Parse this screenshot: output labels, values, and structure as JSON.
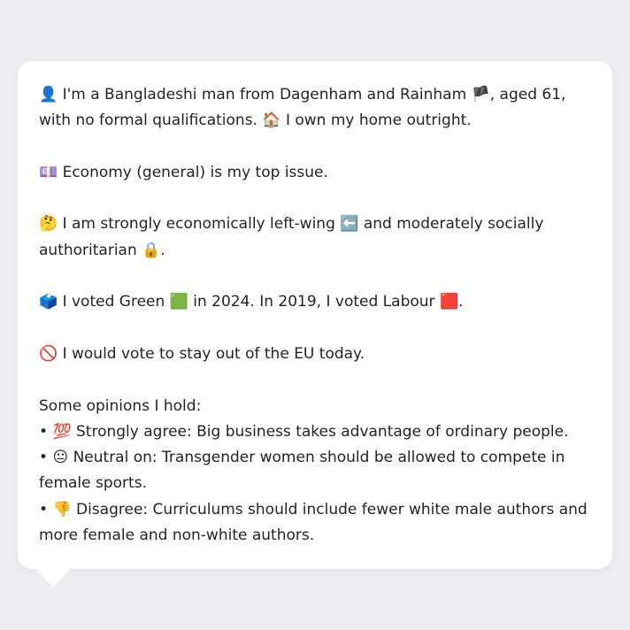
{
  "profile": {
    "intro": {
      "icon": "👤",
      "text1": " I'm a Bangladeshi man from Dagenham and Rainham ",
      "flag": "🏴",
      "text2": ", aged 61, with no formal qualifications. ",
      "home_icon": "🏠",
      "text3": " I own my home outright."
    },
    "issue": {
      "icon": "💷",
      "text": " Economy (general) is my top issue."
    },
    "politics": {
      "icon": "🤔",
      "text1": " I am strongly economically left-wing ",
      "left_icon": "⬅️",
      "text2": " and moderately socially authoritarian ",
      "lock_icon": "🔒",
      "text3": "."
    },
    "votes": {
      "icon": "🗳️",
      "text1": " I voted Green ",
      "green_icon": "🟩",
      "text2": " in 2024. In 2019, I voted Labour ",
      "red_icon": "🟥",
      "text3": "."
    },
    "eu": {
      "icon": "🚫",
      "text": " I would vote to stay out of the EU today."
    },
    "opinions_heading": "Some opinions I hold:",
    "opinions": [
      {
        "bullet": "• ",
        "icon": "💯",
        "text": " Strongly agree: Big business takes advantage of ordinary people."
      },
      {
        "bullet": "• ",
        "icon": "😐",
        "text": " Neutral on: Transgender women should be allowed to compete in female sports."
      },
      {
        "bullet": "• ",
        "icon": "👎",
        "text": " Disagree: Curriculums should include fewer white male authors and more female and non-white authors."
      }
    ]
  },
  "colors": {
    "background": "#eceef1",
    "bubble": "#ffffff",
    "text": "#1f2328"
  }
}
